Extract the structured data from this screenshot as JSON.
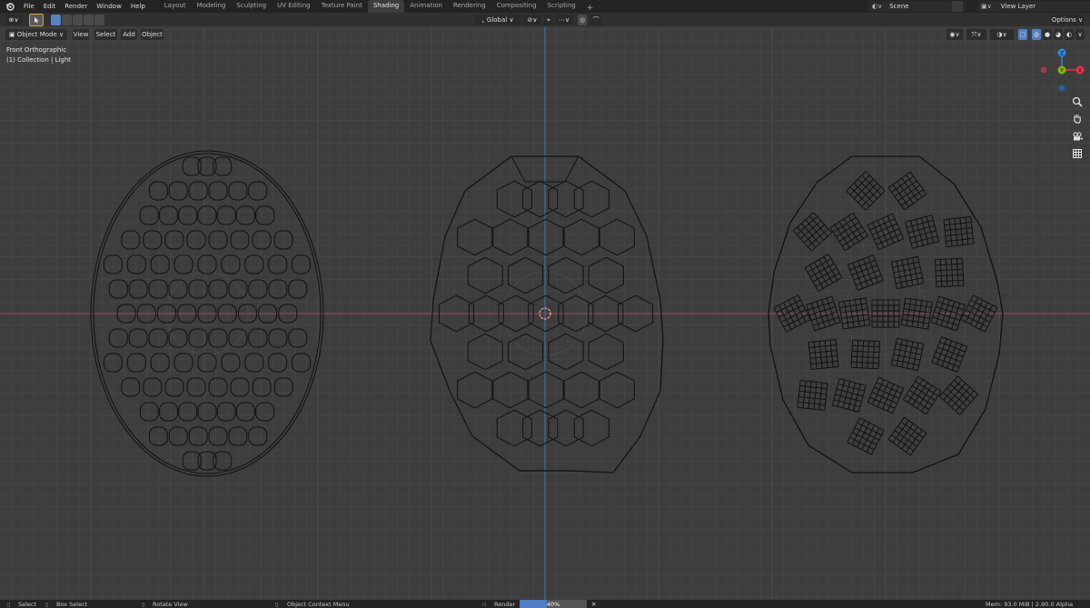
{
  "menu": {
    "items": [
      "File",
      "Edit",
      "Render",
      "Window",
      "Help"
    ]
  },
  "workspaces": {
    "tabs": [
      "Layout",
      "Modeling",
      "Sculpting",
      "UV Editing",
      "Texture Paint",
      "Shading",
      "Animation",
      "Rendering",
      "Compositing",
      "Scripting"
    ],
    "active": "Shading"
  },
  "scene": {
    "label": "Scene"
  },
  "view_layer": {
    "label": "View Layer"
  },
  "toolbar": {
    "transform_orientation": "Global",
    "options_label": "Options"
  },
  "viewport_header": {
    "mode": "Object Mode",
    "view": "View",
    "select": "Select",
    "add": "Add",
    "object": "Object"
  },
  "viewport": {
    "view_name": "Front Orthographic",
    "collection_info": "(1) Collection | Light"
  },
  "gizmo": {
    "z_label": "Z",
    "y_label": "Y",
    "x_label": "X",
    "colors": {
      "x": "#e2344a",
      "y": "#7fb518",
      "z": "#2c8ae8"
    }
  },
  "icons": [
    "blender-logo-icon",
    "cursor-tool-icon",
    "zoom-icon",
    "hand-pan-icon",
    "camera-icon",
    "grid-icon"
  ],
  "status": {
    "select": "Select",
    "box_select": "Box Select",
    "rotate_view": "Rotate View",
    "context_menu": "Object Context Menu",
    "render_label": "Render",
    "render_progress_text": "40%",
    "render_progress": 0.4,
    "memory": "Mem: 93.0 MiB | 2.90.0 Alpha"
  }
}
